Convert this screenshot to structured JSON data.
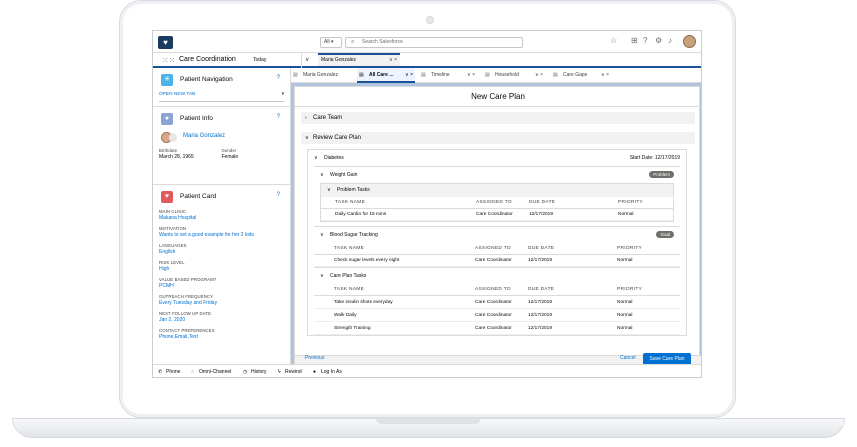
{
  "topbar": {
    "search_scope": "All ▾",
    "search_placeholder": "Search Salesforce"
  },
  "nav": {
    "app_name": "Care Coordination",
    "today_label": "Today",
    "open_tab_label": "Maria Gonzalez"
  },
  "subtabs": [
    {
      "label": "Maria Gonzalez"
    },
    {
      "label": "All Care ..."
    },
    {
      "label": "Timeline"
    },
    {
      "label": "Household"
    },
    {
      "label": "Care Gaps"
    }
  ],
  "patient_navigation": {
    "title": "Patient Navigation",
    "open_new_tab": "OPEN NEW TAB"
  },
  "patient_info": {
    "title": "Patient Info",
    "name": "Maria Gonzalez",
    "birthdate_label": "Birthdate",
    "birthdate": "March 28, 1965",
    "gender_label": "Gender",
    "gender": "Female"
  },
  "patient_card": {
    "title": "Patient Card",
    "fields": [
      {
        "label": "MAIN CLINIC",
        "value": "Makana Hospital"
      },
      {
        "label": "MOTIVATION",
        "value": "Wants to set a good example for her 2 kids"
      },
      {
        "label": "LANGUAGES",
        "value": "English"
      },
      {
        "label": "RISK LEVEL",
        "value": "High"
      },
      {
        "label": "VALUE BASED PROGRAM?",
        "value": "PCMH"
      },
      {
        "label": "OUTREACH FREQUENCY",
        "value": "Every Tuesday and Friday"
      },
      {
        "label": "NEXT FOLLOW UP DATE",
        "value": "Jan 2, 2020"
      },
      {
        "label": "CONTACT PREFERENCES",
        "value": "Phone,Email,Text"
      }
    ]
  },
  "modal": {
    "title": "New Care Plan",
    "care_team": "Care Team",
    "review": "Review Care Plan",
    "diabetes": {
      "label": "Diabetes",
      "start_date": "Start Date: 12/17/2019"
    },
    "weight_gain": {
      "label": "Weight Gain",
      "badge": "Problem"
    },
    "problem_tasks": {
      "label": "Problem Tasks",
      "columns": [
        "TASK NAME",
        "ASSIGNED TO",
        "DUE DATE",
        "PRIORITY"
      ],
      "rows": [
        [
          "Daily Cardio for 15 mins",
          "Care Coordinator",
          "12/17/2019",
          "Normal"
        ]
      ]
    },
    "blood_sugar": {
      "label": "Blood Sugar Tracking",
      "badge": "Goal",
      "columns": [
        "TASK NAME",
        "ASSIGNED TO",
        "DUE DATE",
        "PRIORITY"
      ],
      "rows": [
        [
          "Check sugar levels every night",
          "Care Coordinator",
          "12/17/2019",
          "Normal"
        ]
      ]
    },
    "care_plan_tasks": {
      "label": "Care Plan Tasks",
      "columns": [
        "TASK NAME",
        "ASSIGNED TO",
        "DUE DATE",
        "PRIORITY"
      ],
      "rows": [
        [
          "Take insulin shots everyday",
          "Care Coordinator",
          "12/17/2019",
          "Normal"
        ],
        [
          "Walk Daily",
          "Care Coordinator",
          "12/17/2019",
          "Normal"
        ],
        [
          "Strength Training",
          "Care Coordinator",
          "12/17/2019",
          "Normal"
        ]
      ]
    },
    "previous": "Previous",
    "cancel": "Cancel",
    "save": "Save Care Plan"
  },
  "utility_bar": {
    "phone": "Phone",
    "omni": "Omni-Channel",
    "history": "History",
    "rewind": "Rewind",
    "login_as": "Log In As"
  },
  "icons": {
    "navigation": "navigation-icon",
    "patient_info": "person-icon",
    "patient_card": "heart-icon"
  },
  "colors": {
    "brand": "#1b5297",
    "link": "#0070d2",
    "heart": "#e05a5a",
    "person": "#8ba3d7",
    "navigation": "#4bb3e8"
  }
}
